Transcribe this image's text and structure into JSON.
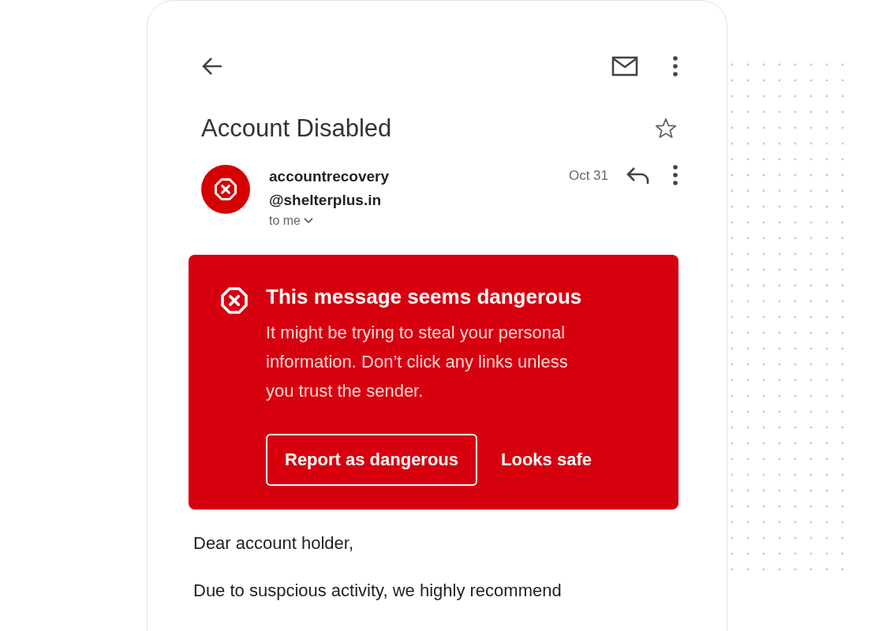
{
  "email": {
    "subject": "Account Disabled",
    "starred": false,
    "sender": {
      "address_line_1": "accountrecovery",
      "address_line_2": "@shelterplus.in",
      "recipient": "to me",
      "date": "Oct 31"
    }
  },
  "warning": {
    "title": "This message seems dangerous",
    "text": "It might be trying to steal your personal information. Don’t click any links unless you trust the sender.",
    "buttons": [
      {
        "label": "Report as dangerous",
        "kind": "outlined"
      },
      {
        "label": "Looks safe",
        "kind": "text"
      }
    ]
  },
  "body": [
    "Dear account holder,",
    "Due to suspcious activity, we highly recommend"
  ]
}
